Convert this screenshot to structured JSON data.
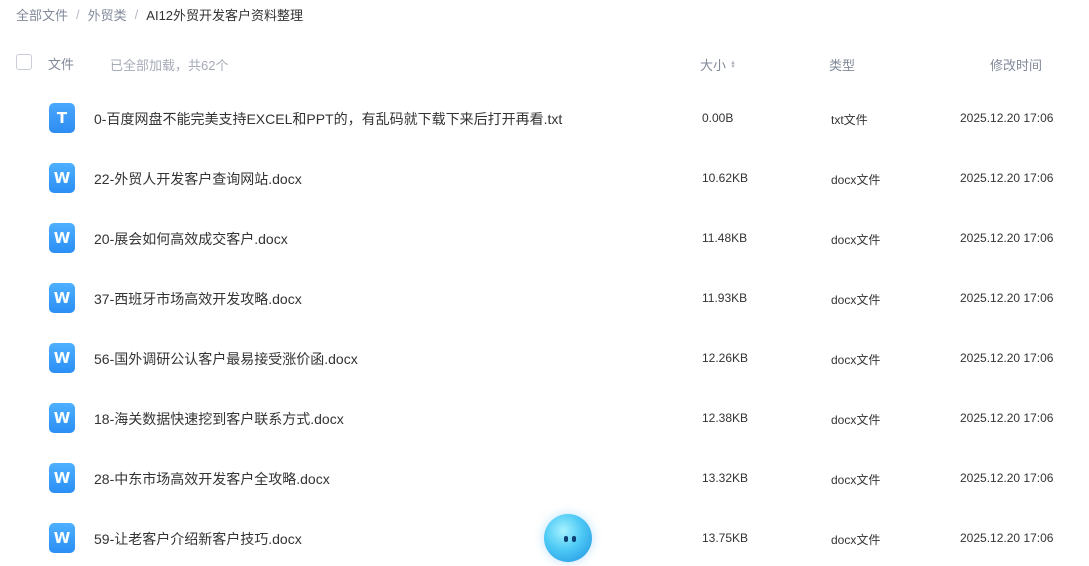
{
  "breadcrumb": {
    "root": "全部文件",
    "folder": "外贸类",
    "current": "AI12外贸开发客户资料整理",
    "separator": "/"
  },
  "header": {
    "file_label": "文件",
    "loaded_text": "已全部加载，共62个",
    "size_label": "大小",
    "type_label": "类型",
    "time_label": "修改时间"
  },
  "icons": {
    "txt_letter": "T",
    "docx_letter": "W"
  },
  "files": [
    {
      "name": "0-百度网盘不能完美支持EXCEL和PPT的，有乱码就下载下来后打开再看.txt",
      "size": "0.00B",
      "type": "txt文件",
      "time": "2025.12.20 17:06"
    },
    {
      "name": "22-外贸人开发客户查询网站.docx",
      "size": "10.62KB",
      "type": "docx文件",
      "time": "2025.12.20 17:06"
    },
    {
      "name": "20-展会如何高效成交客户.docx",
      "size": "11.48KB",
      "type": "docx文件",
      "time": "2025.12.20 17:06"
    },
    {
      "name": "37-西班牙市场高效开发攻略.docx",
      "size": "11.93KB",
      "type": "docx文件",
      "time": "2025.12.20 17:06"
    },
    {
      "name": "56-国外调研公认客户最易接受涨价函.docx",
      "size": "12.26KB",
      "type": "docx文件",
      "time": "2025.12.20 17:06"
    },
    {
      "name": "18-海关数据快速挖到客户联系方式.docx",
      "size": "12.38KB",
      "type": "docx文件",
      "time": "2025.12.20 17:06"
    },
    {
      "name": "28-中东市场高效开发客户全攻略.docx",
      "size": "13.32KB",
      "type": "docx文件",
      "time": "2025.12.20 17:06"
    },
    {
      "name": "59-让老客户介绍新客户技巧.docx",
      "size": "13.75KB",
      "type": "docx文件",
      "time": "2025.12.20 17:06"
    }
  ]
}
